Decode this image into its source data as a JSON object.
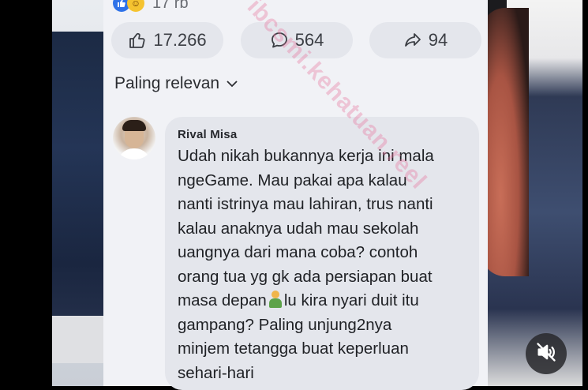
{
  "post": {
    "reaction_count": "17 rb",
    "actions": {
      "like_count": "17.266",
      "comment_count": "564",
      "share_count": "94"
    },
    "sort_label": "Paling relevan"
  },
  "comment": {
    "author": "Rival Misa",
    "lines": [
      "Udah nikah bukannya kerja ini mala",
      "ngeGame. Mau pakai apa kalau",
      "nanti istrinya mau lahiran, trus nanti",
      "kalau anaknya udah mau sekolah",
      "uangnya dari mana coba? contoh",
      "orang tua yg gk ada persiapan buat",
      "masa depan",
      "lu kira nyari duit itu",
      "gampang? Paling unjung2nya",
      "minjem tetangga buat keperluan",
      "sehari-hari"
    ]
  },
  "overlay": {
    "watermark": "ibcsmi.kehatuan.reel"
  },
  "colors": {
    "bubble": "#e4e6ec",
    "pill": "#e4e6ec",
    "like_blue": "#2f72e8",
    "watermark_pink": "#e878a0"
  }
}
